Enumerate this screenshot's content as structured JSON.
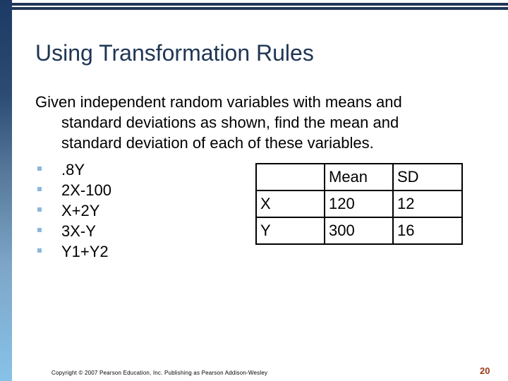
{
  "slide": {
    "title": "Using Transformation Rules",
    "intro_lines": [
      "Given independent random variables with means and",
      "standard deviations as shown, find the mean and",
      "standard deviation of each of these variables."
    ],
    "bullets": [
      {
        "text": ".8Y"
      },
      {
        "text": "2X-100"
      },
      {
        "text": "X+2Y"
      },
      {
        "text": "3X-Y"
      },
      {
        "text": "Y1+Y2"
      }
    ],
    "table": {
      "headers": [
        "",
        "Mean",
        "SD"
      ],
      "rows": [
        [
          "X",
          "120",
          "12"
        ],
        [
          "Y",
          "300",
          "16"
        ]
      ]
    },
    "footer": {
      "copyright": "Copyright © 2007 Pearson Education, Inc. Publishing as Pearson Addison-Wesley",
      "page_number": "20"
    }
  },
  "colors": {
    "title": "#1f3555",
    "accent_bar_top": "#1c3a64",
    "accent_bar_bottom": "#87c2e8",
    "bullet": "#8bb7de",
    "page_number": "#9c3a1a"
  }
}
